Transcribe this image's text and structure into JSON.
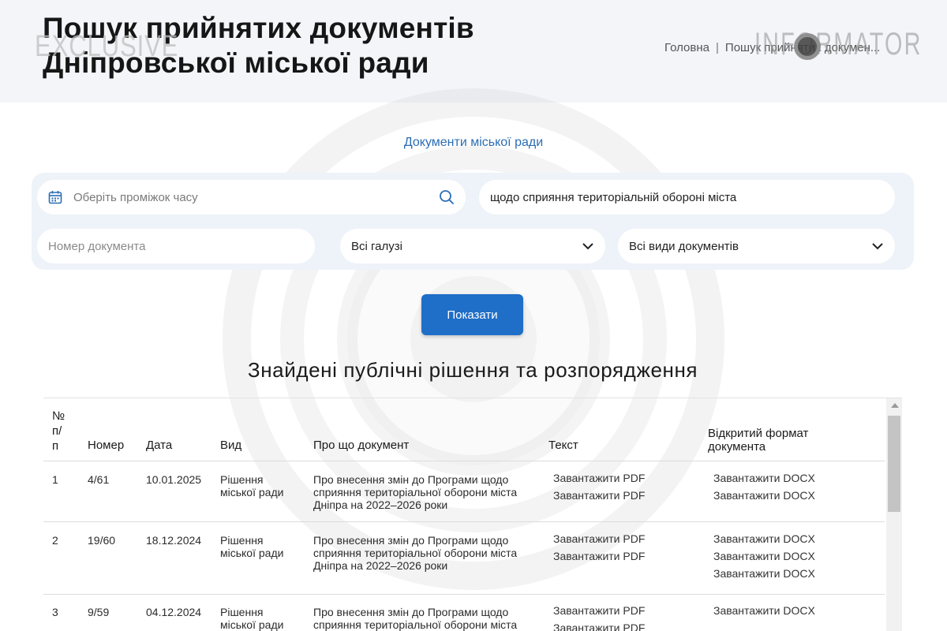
{
  "header": {
    "title_line1": "Пошук прийнятих документів",
    "title_line2": "Дніпровської міської ради",
    "breadcrumb_home": "Головна",
    "breadcrumb_separator": "|",
    "breadcrumb_current": "Пошук прийнятих докумен..."
  },
  "watermarks": {
    "exclusive": "EXCLUSIVE",
    "informator": "INFORMATOR"
  },
  "documents_link": "Документи міської ради",
  "filters": {
    "date_placeholder": "Оберіть проміжок часу",
    "query_value": "щодо сприяння територіальній обороні міста",
    "number_placeholder": "Номер документа",
    "branch_selected": "Всі галузі",
    "type_selected": "Всі види документів"
  },
  "show_button": "Показати",
  "results_title": "Знайдені публічні рішення та розпорядження",
  "table": {
    "headers": {
      "index_l1": "№",
      "index_l2": "п/",
      "index_l3": "п",
      "number": "Номер",
      "date": "Дата",
      "kind": "Вид",
      "about": "Про що документ",
      "text": "Текст",
      "open_format_l1": "Відкритий формат",
      "open_format_l2": "документа"
    },
    "rows": [
      {
        "index": "1",
        "number": "4/61",
        "date": "10.01.2025",
        "kind_l1": "Рішення",
        "kind_l2": "міської ради",
        "about_l1": "Про внесення змін до Програми щодо",
        "about_l2": "сприяння територіальної оборони міста",
        "about_l3": "Дніпра на 2022–2026 роки",
        "pdf": [
          "Завантажити PDF",
          "Завантажити PDF"
        ],
        "docx": [
          "Завантажити DOCX",
          "Завантажити DOCX"
        ]
      },
      {
        "index": "2",
        "number": "19/60",
        "date": "18.12.2024",
        "kind_l1": "Рішення",
        "kind_l2": "міської ради",
        "about_l1": "Про внесення змін до Програми щодо",
        "about_l2": "сприяння територіальної оборони міста",
        "about_l3": "Дніпра на 2022–2026 роки",
        "pdf": [
          "Завантажити PDF",
          "Завантажити PDF"
        ],
        "docx": [
          "Завантажити DOCX",
          "Завантажити DOCX",
          "Завантажити DOCX"
        ]
      },
      {
        "index": "3",
        "number": "9/59",
        "date": "04.12.2024",
        "kind_l1": "Рішення",
        "kind_l2": "міської ради",
        "about_l1": "Про внесення змін до Програми щодо",
        "about_l2": "сприяння територіальної оборони міста",
        "about_l3": "",
        "pdf": [
          "Завантажити PDF",
          "Завантажити PDF"
        ],
        "docx": [
          "Завантажити DOCX"
        ]
      }
    ]
  },
  "colors": {
    "accent_blue": "#1f6ec7",
    "link_blue": "#2a6db3",
    "panel_bg": "#eef3f9",
    "header_bg": "#f3f5f9"
  }
}
